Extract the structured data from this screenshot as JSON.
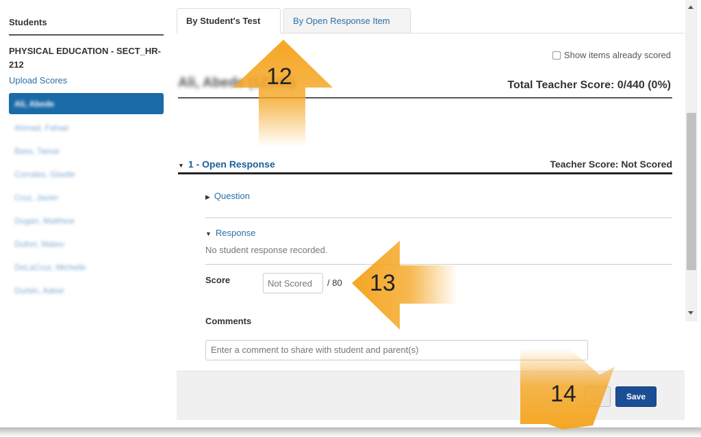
{
  "sidebar": {
    "heading": "Students",
    "course": "PHYSICAL EDUCATION - SECT_HR-212",
    "upload_label": "Upload Scores",
    "students": [
      {
        "name": "Ali, Abede",
        "active": true
      },
      {
        "name": "Ahmad, Fahad",
        "active": false
      },
      {
        "name": "Bass, Tamar",
        "active": false
      },
      {
        "name": "Corrales, Giselle",
        "active": false
      },
      {
        "name": "Cruz, Javier",
        "active": false
      },
      {
        "name": "Dugan, Matthew",
        "active": false
      },
      {
        "name": "Dufort, Mateo",
        "active": false
      },
      {
        "name": "DeLaCruz, Michelle",
        "active": false
      },
      {
        "name": "Durbin, Adeel",
        "active": false
      }
    ]
  },
  "tabs": [
    {
      "label": "By Student's Test",
      "active": true
    },
    {
      "label": "By Open Response Item",
      "active": false
    }
  ],
  "filters": {
    "show_scored_label": "Show items already scored"
  },
  "student": {
    "name": "Ali, Abede (12345)"
  },
  "total_score_label": "Total Teacher Score: 0/440 (0%)",
  "item": {
    "title": "1 - Open Response",
    "teacher_score": "Teacher Score: Not Scored",
    "question_label": "Question",
    "response_label": "Response",
    "no_response": "No student response recorded.",
    "score_label": "Score",
    "score_placeholder": "Not Scored",
    "score_max": "/ 80",
    "comments_label": "Comments",
    "comments_placeholder": "Enter a comment to share with student and parent(s)"
  },
  "footer": {
    "save_label": "Save"
  },
  "annotations": [
    {
      "number": "12",
      "color": "#f5a623"
    },
    {
      "number": "13",
      "color": "#f5a623"
    },
    {
      "number": "14",
      "color": "#f5a623"
    }
  ],
  "colors": {
    "accent": "#1a6aa7",
    "link": "#2a6fa8",
    "save": "#1a4f96",
    "arrow": "#f5a623"
  }
}
